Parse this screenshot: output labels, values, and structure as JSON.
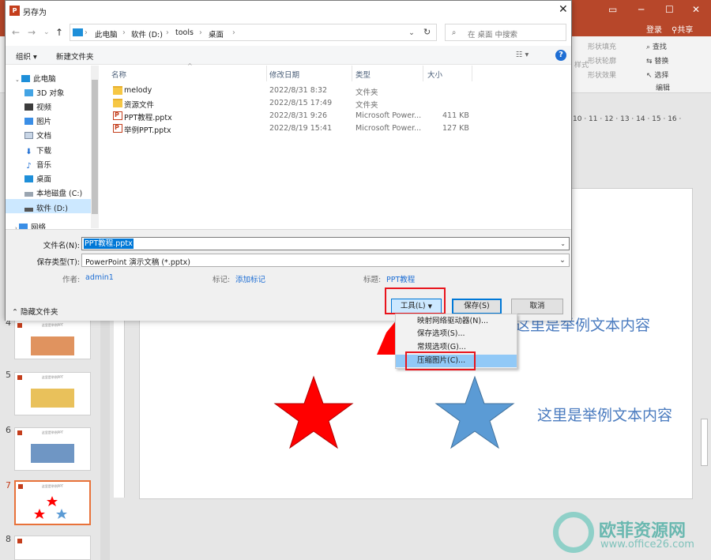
{
  "colors": {
    "accent": "#0078d7",
    "ppt_brand": "#b7472a",
    "highlight_red": "#e8141c",
    "star_red": "#ff0000",
    "star_blue": "#5b9bd5"
  },
  "ppt": {
    "login": "登录",
    "share": "共享",
    "ribbon": {
      "shape_fill": "形状填充",
      "shape_outline": "形状轮廓",
      "shape_effects": "形状效果",
      "find": "查找",
      "replace": "替换",
      "select": "选择",
      "edit_group": "编辑",
      "style": "样式"
    },
    "ruler": "10 · 11 · 12 · 13 · 14 · 15 · 16 ·",
    "thumbs": [
      {
        "num": "4",
        "title": "这里是举例PPT"
      },
      {
        "num": "5",
        "title": "这里是举例PPT"
      },
      {
        "num": "6",
        "title": "这里是举例PPT"
      },
      {
        "num": "7",
        "title": "这里是举例PPT"
      },
      {
        "num": "8",
        "title": ""
      }
    ],
    "slide": {
      "text_top": "这里是举例文本内容",
      "text_bottom": "这里是举例文本内容"
    }
  },
  "dialog": {
    "title": "另存为",
    "app_icon": "P",
    "close": "✕",
    "breadcrumbs": [
      "此电脑",
      "软件 (D:)",
      "tools",
      "桌面"
    ],
    "search_placeholder": "在 桌面 中搜索",
    "toolbar": {
      "organize": "组织",
      "new_folder": "新建文件夹"
    },
    "nav_items": [
      {
        "label": "此电脑",
        "icon": "computer-icon"
      },
      {
        "label": "3D 对象",
        "icon": "cube-icon"
      },
      {
        "label": "视频",
        "icon": "video-icon"
      },
      {
        "label": "图片",
        "icon": "picture-icon"
      },
      {
        "label": "文档",
        "icon": "document-icon"
      },
      {
        "label": "下载",
        "icon": "download-icon"
      },
      {
        "label": "音乐",
        "icon": "music-icon"
      },
      {
        "label": "桌面",
        "icon": "desktop-icon"
      },
      {
        "label": "本地磁盘 (C:)",
        "icon": "drive-icon"
      },
      {
        "label": "软件 (D:)",
        "icon": "drive-icon"
      },
      {
        "label": "网络",
        "icon": "network-icon"
      }
    ],
    "columns": {
      "name": "名称",
      "date": "修改日期",
      "type": "类型",
      "size": "大小"
    },
    "files": [
      {
        "name": "melody",
        "date": "2022/8/31 8:32",
        "type": "文件夹",
        "size": "",
        "icon": "folder-icon"
      },
      {
        "name": "资源文件",
        "date": "2022/8/15 17:49",
        "type": "文件夹",
        "size": "",
        "icon": "folder-icon"
      },
      {
        "name": "PPT教程.pptx",
        "date": "2022/8/31 9:26",
        "type": "Microsoft Power...",
        "size": "411 KB",
        "icon": "pptx-icon"
      },
      {
        "name": "举例PPT.pptx",
        "date": "2022/8/19 15:41",
        "type": "Microsoft Power...",
        "size": "127 KB",
        "icon": "pptx-icon"
      }
    ],
    "form": {
      "filename_label": "文件名(N):",
      "filename_value": "PPT教程.pptx",
      "type_label": "保存类型(T):",
      "type_value": "PowerPoint 演示文稿 (*.pptx)",
      "author_label": "作者:",
      "author_value": "admin1",
      "tags_label": "标记:",
      "tags_value": "添加标记",
      "title_label": "标题:",
      "title_value": "PPT教程"
    },
    "hide_folders": "隐藏文件夹",
    "buttons": {
      "tools": "工具(L)",
      "save": "保存(S)",
      "cancel": "取消"
    },
    "tools_menu": [
      "映射网络驱动器(N)...",
      "保存选项(S)...",
      "常规选项(G)...",
      "压缩图片(C)..."
    ]
  },
  "watermark": {
    "text": "欧菲资源网",
    "url": "www.office26.com"
  }
}
